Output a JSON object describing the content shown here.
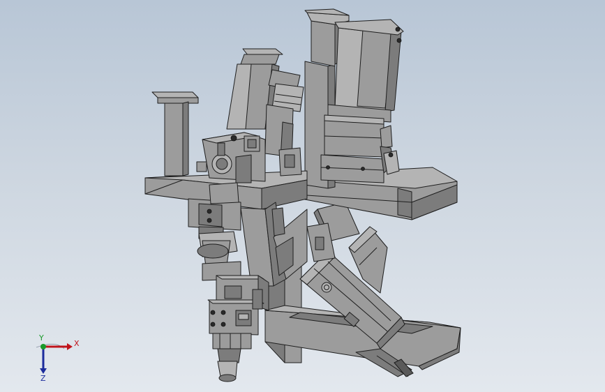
{
  "viewport": {
    "background_top": "#b8c6d6",
    "background_bottom": "#e3e8ee",
    "part_color": "#9a9a9a",
    "edge_color": "#1e1e1e"
  },
  "triad": {
    "x_label": "X",
    "y_label": "Y",
    "z_label": "Z",
    "x_color": "#c0141c",
    "y_color": "#1a9a2a",
    "z_color": "#1c2c9c"
  }
}
